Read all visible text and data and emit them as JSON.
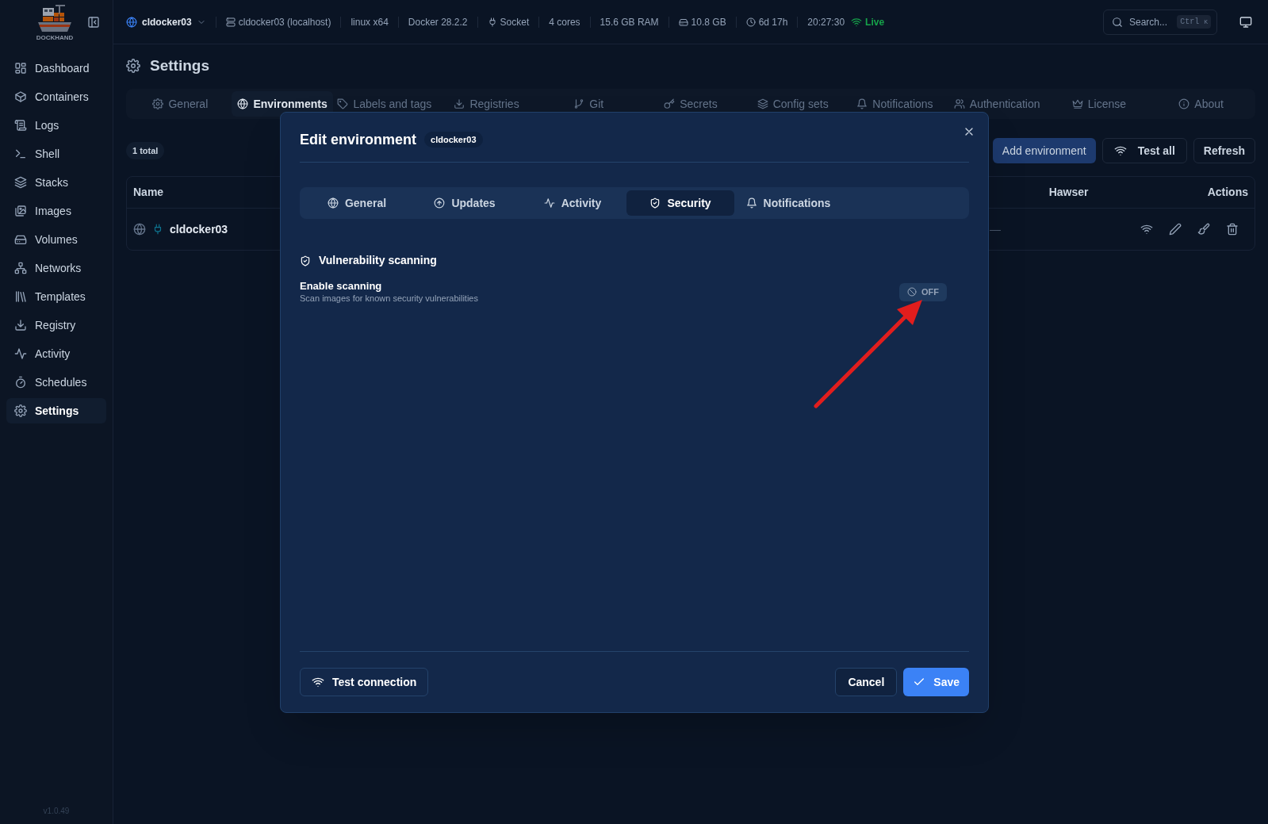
{
  "logo": {
    "text": "DOCKHAND"
  },
  "sidebar": {
    "items": [
      {
        "label": "Dashboard",
        "selected": false
      },
      {
        "label": "Containers",
        "selected": false
      },
      {
        "label": "Logs",
        "selected": false
      },
      {
        "label": "Shell",
        "selected": false
      },
      {
        "label": "Stacks",
        "selected": false
      },
      {
        "label": "Images",
        "selected": false
      },
      {
        "label": "Volumes",
        "selected": false
      },
      {
        "label": "Networks",
        "selected": false
      },
      {
        "label": "Templates",
        "selected": false
      },
      {
        "label": "Registry",
        "selected": false
      },
      {
        "label": "Activity",
        "selected": false
      },
      {
        "label": "Schedules",
        "selected": false
      },
      {
        "label": "Settings",
        "selected": true
      }
    ],
    "version": "v1.0.49"
  },
  "topbar": {
    "environment": "cldocker03",
    "info": [
      {
        "kind": "host",
        "text": "cldocker03 (localhost)"
      },
      {
        "kind": "plain",
        "text": "linux x64"
      },
      {
        "kind": "plain",
        "text": "Docker 28.2.2"
      },
      {
        "kind": "socket",
        "text": "Socket"
      },
      {
        "kind": "plain",
        "text": "4 cores"
      },
      {
        "kind": "plain",
        "text": "15.6 GB RAM"
      },
      {
        "kind": "disk",
        "text": "10.8 GB"
      },
      {
        "kind": "clock",
        "text": "6d 17h"
      }
    ],
    "time": "20:27:30",
    "status": "Live",
    "search": {
      "placeholder": "Search...",
      "keys": [
        "Ctrl",
        "K"
      ]
    }
  },
  "page": {
    "title": "Settings",
    "tabs": [
      {
        "label": "General",
        "selected": false
      },
      {
        "label": "Environments",
        "selected": true
      },
      {
        "label": "Labels and tags",
        "selected": false
      },
      {
        "label": "Registries",
        "selected": false
      },
      {
        "label": "Git",
        "selected": false
      },
      {
        "label": "Secrets",
        "selected": false
      },
      {
        "label": "Config sets",
        "selected": false
      },
      {
        "label": "Notifications",
        "selected": false
      },
      {
        "label": "Authentication",
        "selected": false
      },
      {
        "label": "License",
        "selected": false
      },
      {
        "label": "About",
        "selected": false
      }
    ]
  },
  "environments": {
    "count": "1 total",
    "buttons": [
      "Add environment",
      "Test all",
      "Refresh"
    ],
    "table": {
      "columns": [
        "Name",
        "Hawser",
        "Actions"
      ],
      "rows": [
        {
          "name": "cldocker03",
          "hawser": "—"
        }
      ]
    }
  },
  "modal": {
    "title": "Edit environment",
    "badge": "cldocker03",
    "tabs": [
      {
        "label": "General",
        "selected": false
      },
      {
        "label": "Updates",
        "selected": false
      },
      {
        "label": "Activity",
        "selected": false
      },
      {
        "label": "Security",
        "selected": true
      },
      {
        "label": "Notifications",
        "selected": false
      }
    ],
    "section": "Vulnerability scanning",
    "setting": {
      "label": "Enable scanning",
      "description": "Scan images for known security vulnerabilities",
      "on": false,
      "state_text": "OFF"
    },
    "buttons": {
      "test": "Test connection",
      "cancel": "Cancel",
      "save": "Save"
    }
  }
}
